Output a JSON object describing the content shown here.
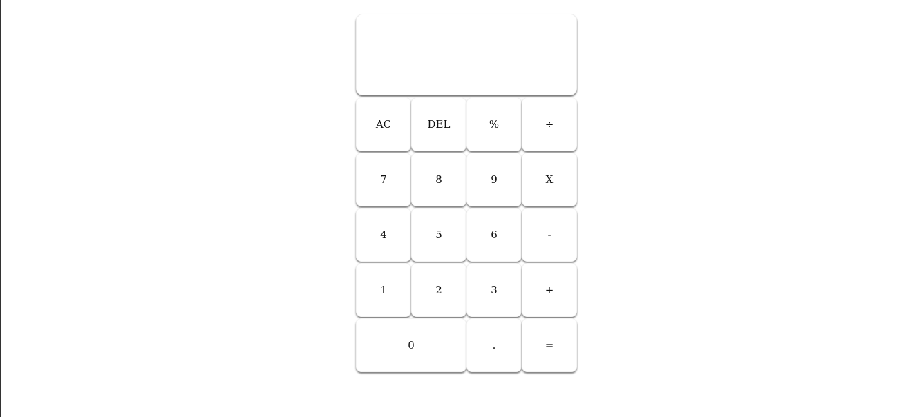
{
  "display": {
    "previous_operand": "",
    "current_operand": ""
  },
  "keys": {
    "all_clear": "AC",
    "delete": "DEL",
    "percent": "%",
    "divide": "÷",
    "seven": "7",
    "eight": "8",
    "nine": "9",
    "multiply": "X",
    "four": "4",
    "five": "5",
    "six": "6",
    "subtract": "-",
    "one": "1",
    "two": "2",
    "three": "3",
    "add": "+",
    "zero": "0",
    "decimal": ".",
    "equals": "="
  }
}
